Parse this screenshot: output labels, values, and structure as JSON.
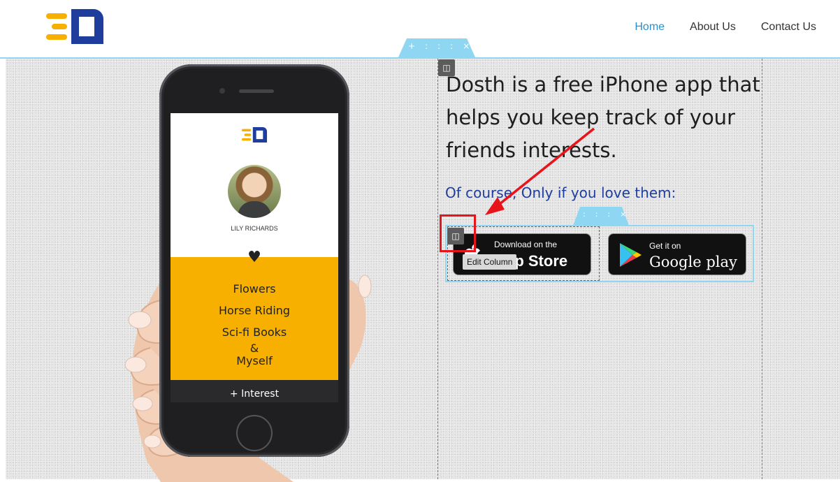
{
  "header": {
    "logo_icon": "dosth-logo-icon",
    "nav": [
      {
        "label": "Home",
        "active": true
      },
      {
        "label": "About Us",
        "active": false
      },
      {
        "label": "Contact Us",
        "active": false
      }
    ]
  },
  "editor": {
    "section_toolbar": {
      "add": "+",
      "move": ":::",
      "close": "×"
    },
    "row_toolbar": {
      "move": ":::",
      "close": "×"
    },
    "column_icon": "columns-icon",
    "tooltip": "Edit Column"
  },
  "phone": {
    "user_name": "LILY RICHARDS",
    "interests": [
      "Flowers",
      "Horse Riding",
      "Sci-fi Books",
      "&",
      "Myself"
    ],
    "add_button": "+ Interest"
  },
  "main": {
    "headline": "Dosth is a free iPhone app that helps you keep track of your friends interests.",
    "subheadline": "Of course, Only if you love them:",
    "app_store": {
      "small": "Download on the",
      "big": "App Store"
    },
    "google_play": {
      "small": "Get it on",
      "big": "Google play"
    }
  },
  "colors": {
    "accent_blue": "#2a8fd1",
    "guide_blue": "#8fd6f2",
    "phone_yellow": "#f7b000",
    "brand_navy": "#1f3d9c",
    "highlight_red": "#e8141b"
  }
}
